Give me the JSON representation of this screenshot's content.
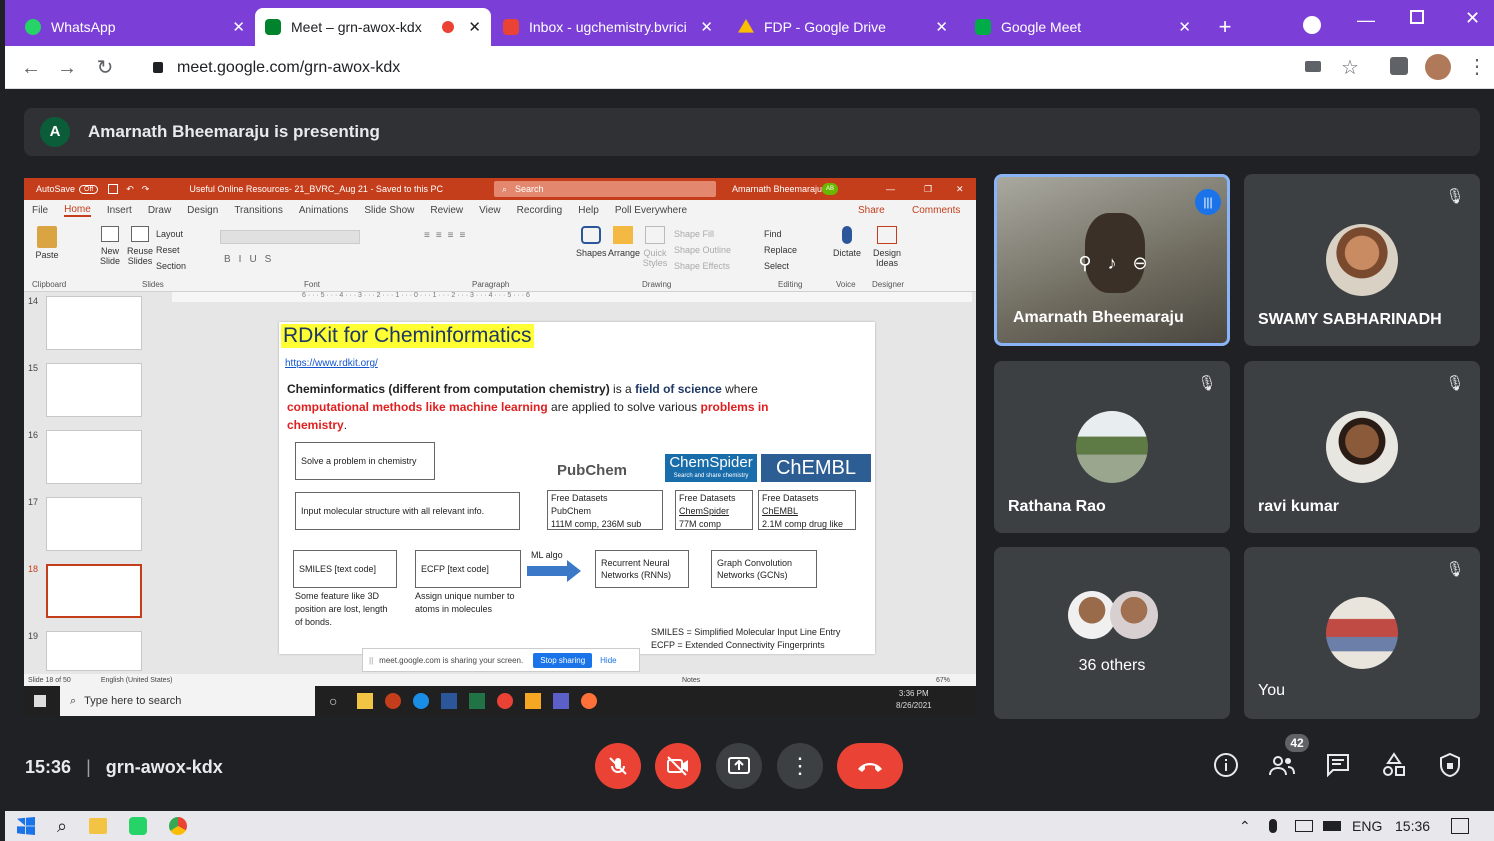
{
  "tabs": [
    {
      "title": "WhatsApp",
      "favcolor": "#25d366"
    },
    {
      "title": "Meet – grn-awox-kdx",
      "favcolor": "#00832d",
      "active": true
    },
    {
      "title": "Inbox - ugchemistry.bvrici",
      "favcolor": "#ea4335"
    },
    {
      "title": "FDP - Google Drive",
      "favcolor": "#fbbc04"
    },
    {
      "title": "Google Meet",
      "favcolor": "#00ac47"
    }
  ],
  "address": {
    "url": "meet.google.com/grn-awox-kdx"
  },
  "presenter": {
    "initial": "A",
    "banner": "Amarnath Bheemaraju is presenting"
  },
  "ppt": {
    "titlebar": {
      "autosave": "AutoSave",
      "autosave_state": "Off",
      "filename": "Useful Online Resources- 21_BVRC_Aug 21  -  Saved to this PC",
      "search": "Search",
      "user": "Amarnath Bheemaraju",
      "user_initials": "AB"
    },
    "menu": [
      "File",
      "Home",
      "Insert",
      "Draw",
      "Design",
      "Transitions",
      "Animations",
      "Slide Show",
      "Review",
      "View",
      "Recording",
      "Help",
      "Poll Everywhere"
    ],
    "share": "Share",
    "comments": "Comments",
    "ribbon": {
      "paste": "Paste",
      "newslide": "New Slide",
      "reuse": "Reuse Slides",
      "layout": "Layout",
      "reset": "Reset",
      "section": "Section",
      "shapes": "Shapes",
      "arrange": "Arrange",
      "quickstyles": "Quick Styles",
      "shapefill": "Shape Fill",
      "shapeoutline": "Shape Outline",
      "shapeeffects": "Shape Effects",
      "find": "Find",
      "replace": "Replace",
      "select": "Select",
      "dictate": "Dictate",
      "designideas": "Design Ideas",
      "groups": [
        "Clipboard",
        "Slides",
        "Font",
        "Paragraph",
        "Drawing",
        "Editing",
        "Voice",
        "Designer"
      ]
    },
    "ruler": "6 · · · 5 · · · 4 · · · 3 · · · 2 · · · 1 · · · 0 · · · 1 · · · 2 · · · 3 · · · 4 · · · 5 · · · 6",
    "thumb_numbers": [
      "14",
      "15",
      "16",
      "17",
      "18",
      "19"
    ],
    "slide": {
      "title": "RDKit for Cheminformatics",
      "link": "https://www.rdkit.org/",
      "body_1": "Cheminformatics (different from computation chemistry)",
      "body_2": " is a ",
      "body_3": "field of science",
      "body_4": " where ",
      "body_5": "computational methods like machine learning",
      "body_6": " are applied to solve various ",
      "body_7": "problems in chemistry",
      "body_8": ".",
      "box_solve": "Solve a problem in chemistry",
      "box_input": "Input molecular structure with all relevant info.",
      "logo_pubchem": "PubChem",
      "logo_chemspider": "ChemSpider",
      "logo_chemspider_sub": "Search and share chemistry",
      "logo_chembl": "ChEMBL",
      "pubchem_1": "Free Datasets",
      "pubchem_2": "PubChem",
      "pubchem_3": "111M comp, 236M sub",
      "cs_1": "Free Datasets",
      "cs_2": "ChemSpider",
      "cs_3": "77M comp",
      "chembl_1": "Free Datasets",
      "chembl_2": "ChEMBL",
      "chembl_3": "2.1M comp drug like",
      "smiles": "SMILES [text code]",
      "ecfp": "ECFP [text code]",
      "mlalgo": "ML algo",
      "rnn": "Recurrent Neural Networks (RNNs)",
      "gcn": "Graph Convolution Networks (GCNs)",
      "smiles_note": "Some feature like 3D position are lost, length of bonds.",
      "ecfp_note": "Assign unique number to atoms in molecules",
      "def_smiles": "SMILES = Simplified Molecular Input Line Entry",
      "def_ecfp": "ECFP = Extended Connectivity Fingerprints"
    },
    "sharing": {
      "text": "meet.google.com is sharing your screen.",
      "stop": "Stop sharing",
      "hide": "Hide"
    },
    "status": {
      "slide": "Slide 18 of 50",
      "lang": "English (United States)",
      "notes": "Notes",
      "zoom": "67%"
    },
    "taskbar": {
      "search": "Type here to search",
      "time": "3:36 PM",
      "date": "8/26/2021"
    }
  },
  "participants": [
    {
      "name": "Amarnath Bheemaraju",
      "speaking": true
    },
    {
      "name": "SWAMY SABHARINADH"
    },
    {
      "name": "Rathana Rao"
    },
    {
      "name": "ravi kumar"
    },
    {
      "name": "36 others"
    },
    {
      "name": "You"
    }
  ],
  "bottom": {
    "time": "15:36",
    "separator": "|",
    "code": "grn-awox-kdx",
    "people_count": "42"
  },
  "wintaskbar": {
    "lang": "ENG",
    "time": "15:36"
  },
  "colors": {
    "accent": "#8ab4f8",
    "danger": "#ea4335",
    "tabstrip": "#7b3fd8"
  }
}
